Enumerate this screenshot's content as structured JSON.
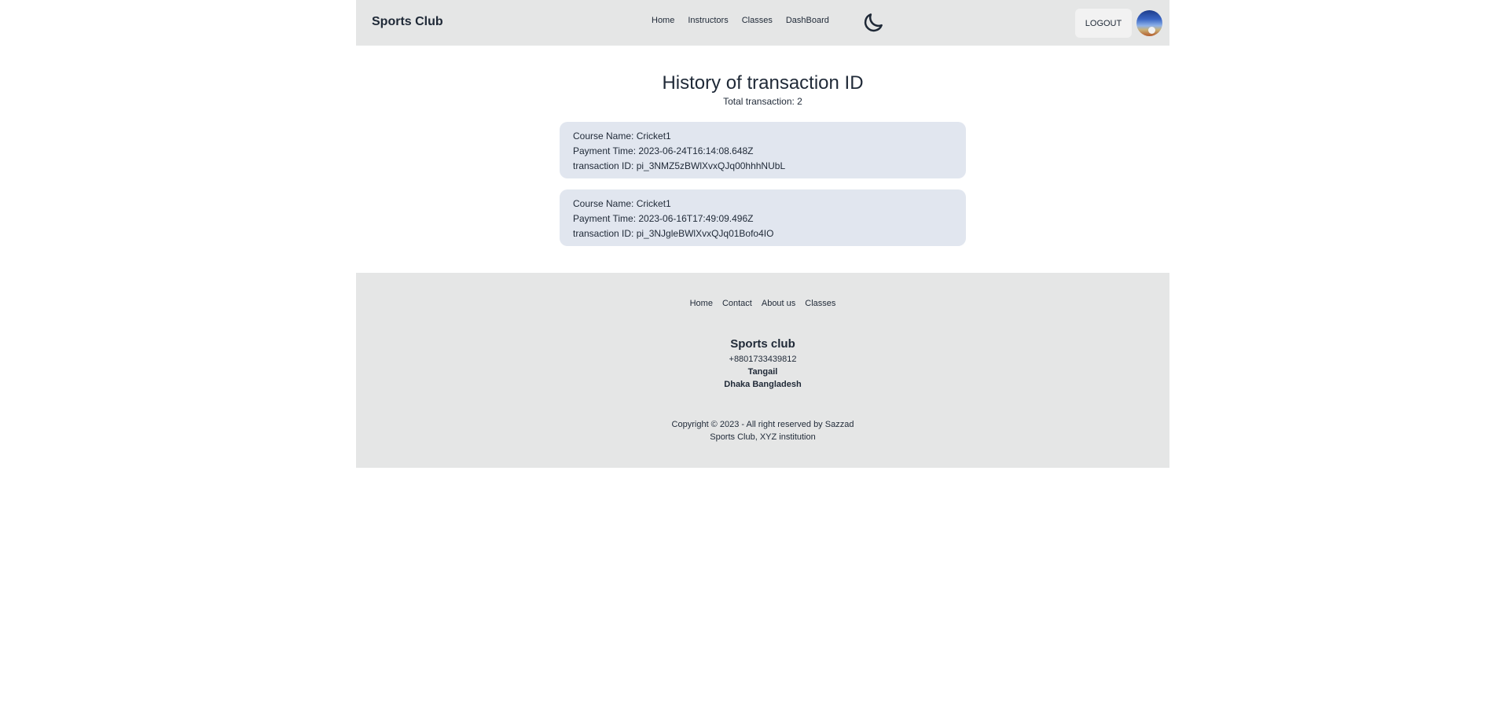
{
  "navbar": {
    "brand": "Sports Club",
    "links": [
      "Home",
      "Instructors",
      "Classes",
      "DashBoard"
    ],
    "theme_icon": "moon-icon",
    "logout_label": "LOGOUT",
    "avatar_icon": "user-avatar"
  },
  "main": {
    "title": "History of transaction ID",
    "subtitle": "Total transaction: 2",
    "transactions": [
      {
        "course": "Course Name: Cricket1",
        "time": "Payment Time: 2023-06-24T16:14:08.648Z",
        "id": "transaction ID: pi_3NMZ5zBWlXvxQJq00hhhNUbL"
      },
      {
        "course": "Course Name: Cricket1",
        "time": "Payment Time: 2023-06-16T17:49:09.496Z",
        "id": "transaction ID: pi_3NJgleBWlXvxQJq01Bofo4IO"
      }
    ]
  },
  "footer": {
    "links": [
      "Home",
      "Contact",
      "About us",
      "Classes"
    ],
    "name": "Sports club",
    "phone": "+8801733439812",
    "city": "Tangail",
    "country": "Dhaka Bangladesh",
    "copyright_line1": "Copyright © 2023 - All right reserved by Sazzad",
    "copyright_line2": "Sports Club, XYZ institution"
  },
  "colors": {
    "navbar_bg": "#e5e6e6",
    "card_bg": "#e1e6ef",
    "text": "#1f2937"
  }
}
